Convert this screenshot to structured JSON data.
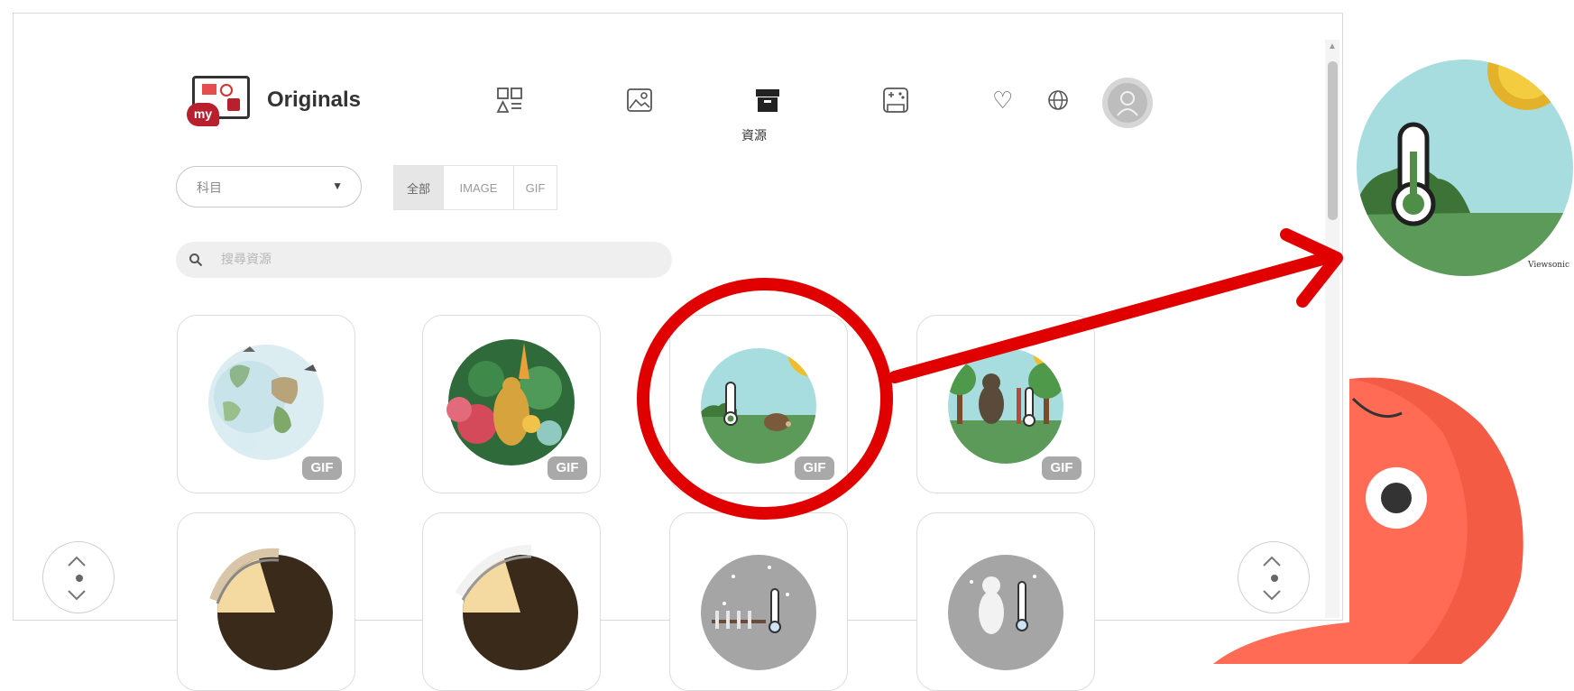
{
  "app": {
    "title": "Originals",
    "logo_badge": "my"
  },
  "nav": {
    "items": [
      {
        "icon": "apps-grid-icon",
        "label": ""
      },
      {
        "icon": "image-icon",
        "label": ""
      },
      {
        "icon": "archive-box-icon",
        "label": "資源",
        "active": true
      },
      {
        "icon": "game-icon",
        "label": ""
      }
    ],
    "favorites_icon": "heart-icon",
    "language_icon": "globe-icon",
    "avatar_icon": "user-avatar-icon"
  },
  "filters": {
    "subject_select": "科目",
    "types": [
      "全部",
      "IMAGE",
      "GIF"
    ],
    "active_type": "全部"
  },
  "search": {
    "placeholder": "搜尋資源"
  },
  "resources": [
    {
      "name": "world-map-globe",
      "badge": "GIF"
    },
    {
      "name": "tropical-forest-animals",
      "badge": "GIF"
    },
    {
      "name": "thermometer-hedgehog-meadow",
      "badge": "GIF"
    },
    {
      "name": "thermometer-bear-forest",
      "badge": "GIF"
    },
    {
      "name": "hair-follicle-cross-section",
      "badge": ""
    },
    {
      "name": "hair-follicle-cross-section-2",
      "badge": ""
    },
    {
      "name": "thermometer-snow-fence",
      "badge": ""
    },
    {
      "name": "thermometer-polar-bear-snow",
      "badge": ""
    }
  ],
  "colors": {
    "annotation_red": "#e00000",
    "mascot_red": "#f35b45",
    "sky": "#a8dde0",
    "grass": "#5b9a58",
    "sun": "#efbc2a"
  }
}
